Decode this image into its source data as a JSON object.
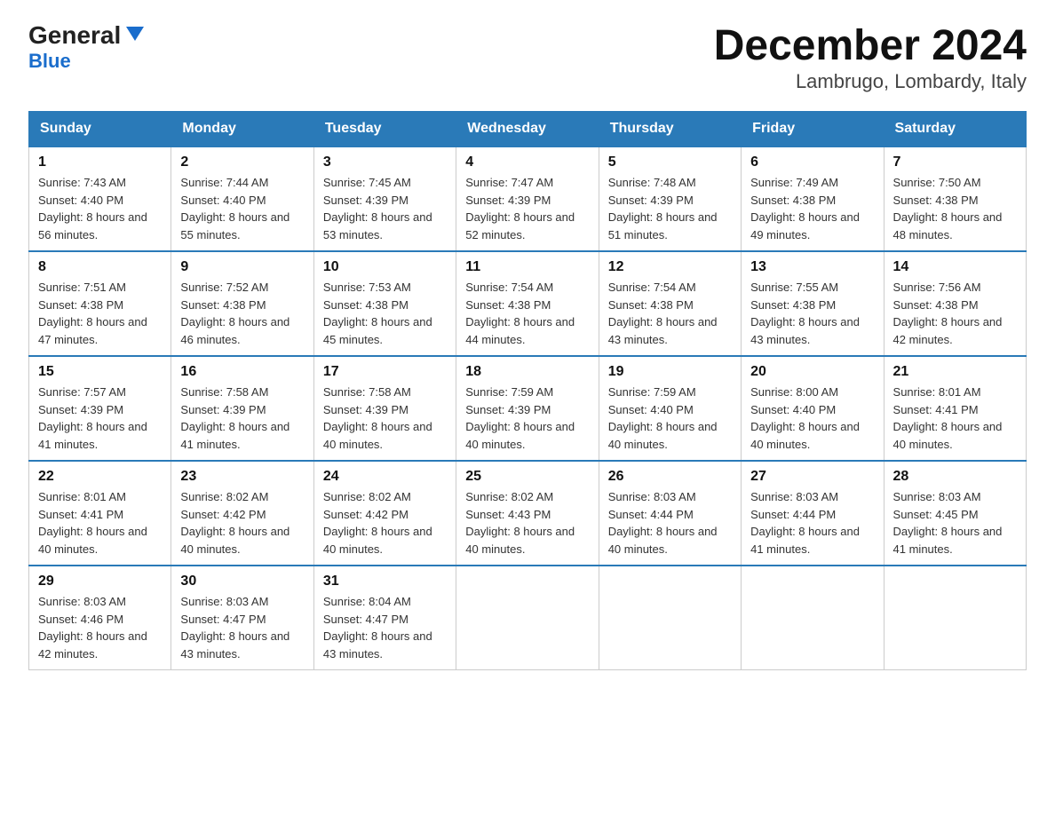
{
  "header": {
    "logo_general": "General",
    "logo_blue": "Blue",
    "month_title": "December 2024",
    "location": "Lambrugo, Lombardy, Italy"
  },
  "weekdays": [
    "Sunday",
    "Monday",
    "Tuesday",
    "Wednesday",
    "Thursday",
    "Friday",
    "Saturday"
  ],
  "weeks": [
    [
      {
        "day": "1",
        "sunrise": "7:43 AM",
        "sunset": "4:40 PM",
        "daylight": "8 hours and 56 minutes."
      },
      {
        "day": "2",
        "sunrise": "7:44 AM",
        "sunset": "4:40 PM",
        "daylight": "8 hours and 55 minutes."
      },
      {
        "day": "3",
        "sunrise": "7:45 AM",
        "sunset": "4:39 PM",
        "daylight": "8 hours and 53 minutes."
      },
      {
        "day": "4",
        "sunrise": "7:47 AM",
        "sunset": "4:39 PM",
        "daylight": "8 hours and 52 minutes."
      },
      {
        "day": "5",
        "sunrise": "7:48 AM",
        "sunset": "4:39 PM",
        "daylight": "8 hours and 51 minutes."
      },
      {
        "day": "6",
        "sunrise": "7:49 AM",
        "sunset": "4:38 PM",
        "daylight": "8 hours and 49 minutes."
      },
      {
        "day": "7",
        "sunrise": "7:50 AM",
        "sunset": "4:38 PM",
        "daylight": "8 hours and 48 minutes."
      }
    ],
    [
      {
        "day": "8",
        "sunrise": "7:51 AM",
        "sunset": "4:38 PM",
        "daylight": "8 hours and 47 minutes."
      },
      {
        "day": "9",
        "sunrise": "7:52 AM",
        "sunset": "4:38 PM",
        "daylight": "8 hours and 46 minutes."
      },
      {
        "day": "10",
        "sunrise": "7:53 AM",
        "sunset": "4:38 PM",
        "daylight": "8 hours and 45 minutes."
      },
      {
        "day": "11",
        "sunrise": "7:54 AM",
        "sunset": "4:38 PM",
        "daylight": "8 hours and 44 minutes."
      },
      {
        "day": "12",
        "sunrise": "7:54 AM",
        "sunset": "4:38 PM",
        "daylight": "8 hours and 43 minutes."
      },
      {
        "day": "13",
        "sunrise": "7:55 AM",
        "sunset": "4:38 PM",
        "daylight": "8 hours and 43 minutes."
      },
      {
        "day": "14",
        "sunrise": "7:56 AM",
        "sunset": "4:38 PM",
        "daylight": "8 hours and 42 minutes."
      }
    ],
    [
      {
        "day": "15",
        "sunrise": "7:57 AM",
        "sunset": "4:39 PM",
        "daylight": "8 hours and 41 minutes."
      },
      {
        "day": "16",
        "sunrise": "7:58 AM",
        "sunset": "4:39 PM",
        "daylight": "8 hours and 41 minutes."
      },
      {
        "day": "17",
        "sunrise": "7:58 AM",
        "sunset": "4:39 PM",
        "daylight": "8 hours and 40 minutes."
      },
      {
        "day": "18",
        "sunrise": "7:59 AM",
        "sunset": "4:39 PM",
        "daylight": "8 hours and 40 minutes."
      },
      {
        "day": "19",
        "sunrise": "7:59 AM",
        "sunset": "4:40 PM",
        "daylight": "8 hours and 40 minutes."
      },
      {
        "day": "20",
        "sunrise": "8:00 AM",
        "sunset": "4:40 PM",
        "daylight": "8 hours and 40 minutes."
      },
      {
        "day": "21",
        "sunrise": "8:01 AM",
        "sunset": "4:41 PM",
        "daylight": "8 hours and 40 minutes."
      }
    ],
    [
      {
        "day": "22",
        "sunrise": "8:01 AM",
        "sunset": "4:41 PM",
        "daylight": "8 hours and 40 minutes."
      },
      {
        "day": "23",
        "sunrise": "8:02 AM",
        "sunset": "4:42 PM",
        "daylight": "8 hours and 40 minutes."
      },
      {
        "day": "24",
        "sunrise": "8:02 AM",
        "sunset": "4:42 PM",
        "daylight": "8 hours and 40 minutes."
      },
      {
        "day": "25",
        "sunrise": "8:02 AM",
        "sunset": "4:43 PM",
        "daylight": "8 hours and 40 minutes."
      },
      {
        "day": "26",
        "sunrise": "8:03 AM",
        "sunset": "4:44 PM",
        "daylight": "8 hours and 40 minutes."
      },
      {
        "day": "27",
        "sunrise": "8:03 AM",
        "sunset": "4:44 PM",
        "daylight": "8 hours and 41 minutes."
      },
      {
        "day": "28",
        "sunrise": "8:03 AM",
        "sunset": "4:45 PM",
        "daylight": "8 hours and 41 minutes."
      }
    ],
    [
      {
        "day": "29",
        "sunrise": "8:03 AM",
        "sunset": "4:46 PM",
        "daylight": "8 hours and 42 minutes."
      },
      {
        "day": "30",
        "sunrise": "8:03 AM",
        "sunset": "4:47 PM",
        "daylight": "8 hours and 43 minutes."
      },
      {
        "day": "31",
        "sunrise": "8:04 AM",
        "sunset": "4:47 PM",
        "daylight": "8 hours and 43 minutes."
      },
      null,
      null,
      null,
      null
    ]
  ]
}
